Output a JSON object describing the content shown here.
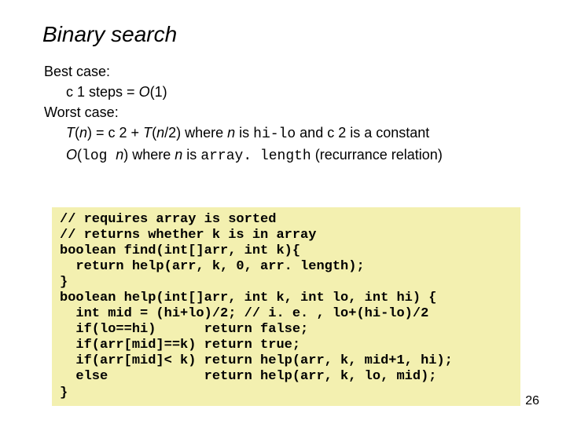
{
  "title": "Binary search",
  "analysis": {
    "best_label": "Best case:",
    "best_value_prefix": "c 1 steps = ",
    "best_value_italic": "O",
    "best_value_suffix": "(1)",
    "worst_label": "Worst case:",
    "recurrence": {
      "t1": "T",
      "p1": "(",
      "n1": "n",
      "p2": ") = c 2 + ",
      "t2": "T",
      "p3": "(",
      "n2": "n",
      "p4": "/2) where ",
      "n3": "n",
      "p5": " is ",
      "code1": "hi-lo",
      "p6": " and c 2 is a constant"
    },
    "closed": {
      "o1": "O",
      "p1": "(",
      "log": "log ",
      "n1": "n",
      "p2": ") where ",
      "n2": "n",
      "p3": " is ",
      "code1": "array. length",
      "p4": " (recurrance relation)"
    }
  },
  "code": "// requires array is sorted\n// returns whether k is in array\nboolean find(int[]arr, int k){\n  return help(arr, k, 0, arr. length);\n}\nboolean help(int[]arr, int k, int lo, int hi) {\n  int mid = (hi+lo)/2; // i. e. , lo+(hi-lo)/2\n  if(lo==hi)      return false;\n  if(arr[mid]==k) return true;\n  if(arr[mid]< k) return help(arr, k, mid+1, hi);\n  else            return help(arr, k, lo, mid);\n}",
  "page_number": "26"
}
